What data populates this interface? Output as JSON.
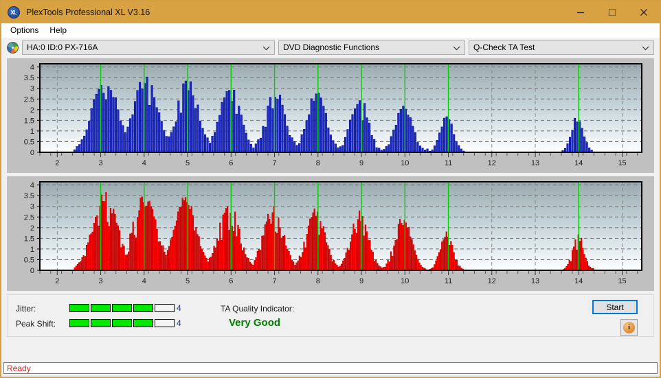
{
  "window": {
    "title": "PlexTools Professional XL V3.16",
    "app_icon": "xl-disc-icon",
    "minimize": "minimize-icon",
    "maximize": "maximize-icon",
    "close": "close-icon"
  },
  "menu": {
    "items": [
      "Options",
      "Help"
    ]
  },
  "toolbar": {
    "drive_icon": "optical-disc-icon",
    "drive": "HA:0 ID:0  PX-716A",
    "function": "DVD Diagnostic Functions",
    "test": "Q-Check TA Test"
  },
  "results": {
    "jitter_label": "Jitter:",
    "jitter_value": "4",
    "jitter_segments_total": 5,
    "jitter_segments_on": 4,
    "peak_shift_label": "Peak Shift:",
    "peak_shift_value": "4",
    "peak_segments_total": 5,
    "peak_segments_on": 4,
    "ta_quality_label": "TA Quality Indicator:",
    "ta_quality_value": "Very Good",
    "ta_quality_color": "#008000",
    "meter_on_color": "#00e800",
    "start_label": "Start",
    "info_label": "i"
  },
  "status": {
    "text": "Ready"
  },
  "chart_data": [
    {
      "type": "bar",
      "name": "jitter-chart",
      "title": "",
      "xlabel": "",
      "ylabel": "",
      "series_color": "#1a2ecc",
      "bar_edge_color": "#0a0a8c",
      "marker_color": "#00d000",
      "xlim": [
        1.6,
        15.45
      ],
      "ylim": [
        0,
        4.15
      ],
      "yticks": [
        0,
        0.5,
        1,
        1.5,
        2,
        2.5,
        3,
        3.5,
        4
      ],
      "ytick_labels": [
        "0",
        "0.5",
        "1",
        "1.5",
        "2",
        "2.5",
        "3",
        "3.5",
        "4"
      ],
      "xticks": [
        2,
        3,
        4,
        5,
        6,
        7,
        8,
        9,
        10,
        11,
        12,
        13,
        14,
        15
      ],
      "xtick_labels": [
        "2",
        "3",
        "4",
        "5",
        "6",
        "7",
        "8",
        "9",
        "10",
        "11",
        "12",
        "13",
        "14",
        "15"
      ],
      "minor_xtick_step": 0.25,
      "grid": true,
      "markers": [
        3,
        4,
        5,
        6,
        7,
        8,
        9,
        10,
        11,
        14
      ],
      "bar_step": 0.0556,
      "peaks": [
        {
          "center": 3.1,
          "height": 3.73,
          "halfwidth": 0.62
        },
        {
          "center": 4.03,
          "height": 3.72,
          "halfwidth": 0.6
        },
        {
          "center": 5.0,
          "height": 3.55,
          "halfwidth": 0.55
        },
        {
          "center": 5.98,
          "height": 3.35,
          "halfwidth": 0.52
        },
        {
          "center": 7.02,
          "height": 3.13,
          "halfwidth": 0.5
        },
        {
          "center": 7.97,
          "height": 2.93,
          "halfwidth": 0.48
        },
        {
          "center": 8.95,
          "height": 2.78,
          "halfwidth": 0.44
        },
        {
          "center": 9.97,
          "height": 2.55,
          "halfwidth": 0.42
        },
        {
          "center": 10.97,
          "height": 1.8,
          "halfwidth": 0.33
        },
        {
          "center": 13.97,
          "height": 1.78,
          "halfwidth": 0.3
        }
      ]
    },
    {
      "type": "bar",
      "name": "peak-shift-chart",
      "title": "",
      "xlabel": "",
      "ylabel": "",
      "series_color": "#fb0000",
      "bar_edge_color": "#c00000",
      "marker_color": "#00d000",
      "xlim": [
        1.6,
        15.45
      ],
      "ylim": [
        0,
        4.15
      ],
      "yticks": [
        0,
        0.5,
        1,
        1.5,
        2,
        2.5,
        3,
        3.5,
        4
      ],
      "ytick_labels": [
        "0",
        "0.5",
        "1",
        "1.5",
        "2",
        "2.5",
        "3",
        "3.5",
        "4"
      ],
      "xticks": [
        2,
        3,
        4,
        5,
        6,
        7,
        8,
        9,
        10,
        11,
        12,
        13,
        14,
        15
      ],
      "xtick_labels": [
        "2",
        "3",
        "4",
        "5",
        "6",
        "7",
        "8",
        "9",
        "10",
        "11",
        "12",
        "13",
        "14",
        "15"
      ],
      "minor_xtick_step": 0.25,
      "grid": true,
      "markers": [
        3,
        4,
        5,
        6,
        7,
        8,
        9,
        10,
        11,
        14
      ],
      "bar_step": 0.0345,
      "peaks": [
        {
          "center": 3.1,
          "height": 3.78,
          "halfwidth": 0.62
        },
        {
          "center": 4.02,
          "height": 3.72,
          "halfwidth": 0.6
        },
        {
          "center": 4.95,
          "height": 3.58,
          "halfwidth": 0.55
        },
        {
          "center": 5.95,
          "height": 3.36,
          "halfwidth": 0.52
        },
        {
          "center": 6.97,
          "height": 3.15,
          "halfwidth": 0.5
        },
        {
          "center": 7.95,
          "height": 2.94,
          "halfwidth": 0.48
        },
        {
          "center": 8.96,
          "height": 2.8,
          "halfwidth": 0.44
        },
        {
          "center": 9.96,
          "height": 2.58,
          "halfwidth": 0.42
        },
        {
          "center": 10.96,
          "height": 1.82,
          "halfwidth": 0.32
        },
        {
          "center": 13.99,
          "height": 1.76,
          "halfwidth": 0.28
        }
      ]
    }
  ]
}
